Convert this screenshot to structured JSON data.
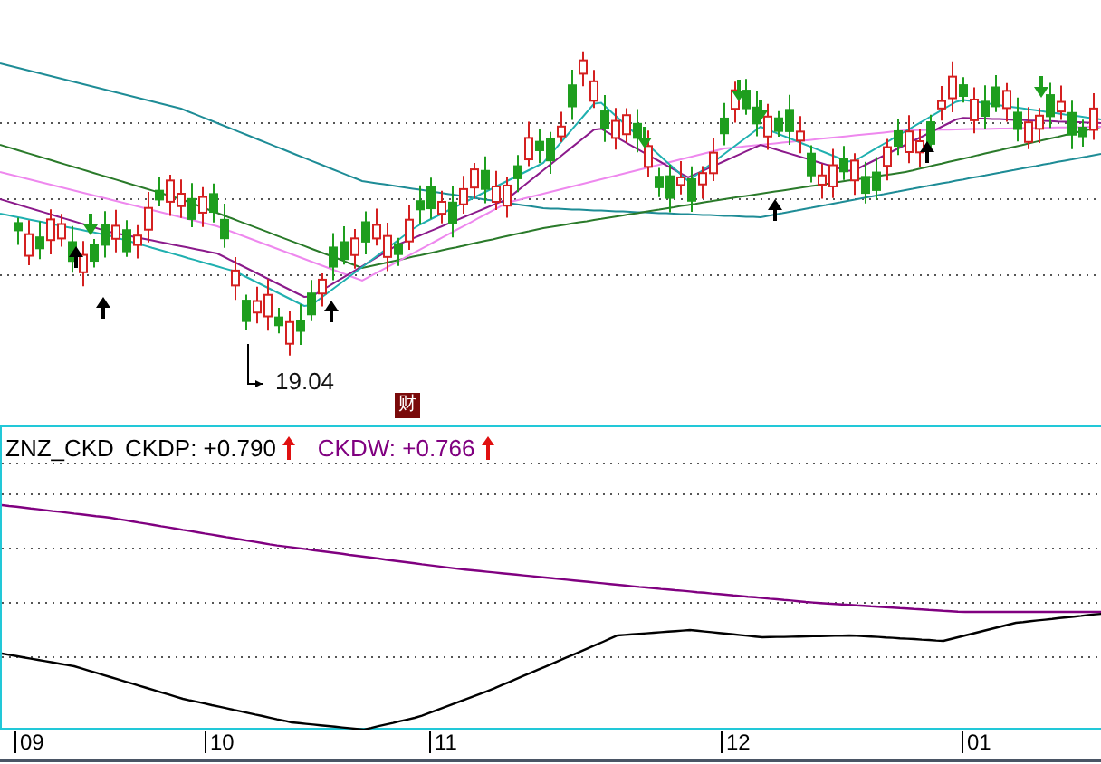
{
  "price_chart": {
    "low_label": "19.04",
    "badge": "财"
  },
  "indicator": {
    "name": "ZNZ_CKD",
    "series": [
      {
        "label": "CKDP:",
        "value": "+0.790",
        "rising": true,
        "color": "#000000"
      },
      {
        "label": "CKDW:",
        "value": "+0.766",
        "rising": true,
        "color": "#800080"
      }
    ]
  },
  "x_axis": {
    "labels": [
      "09",
      "10",
      "11",
      "12",
      "01"
    ]
  }
}
